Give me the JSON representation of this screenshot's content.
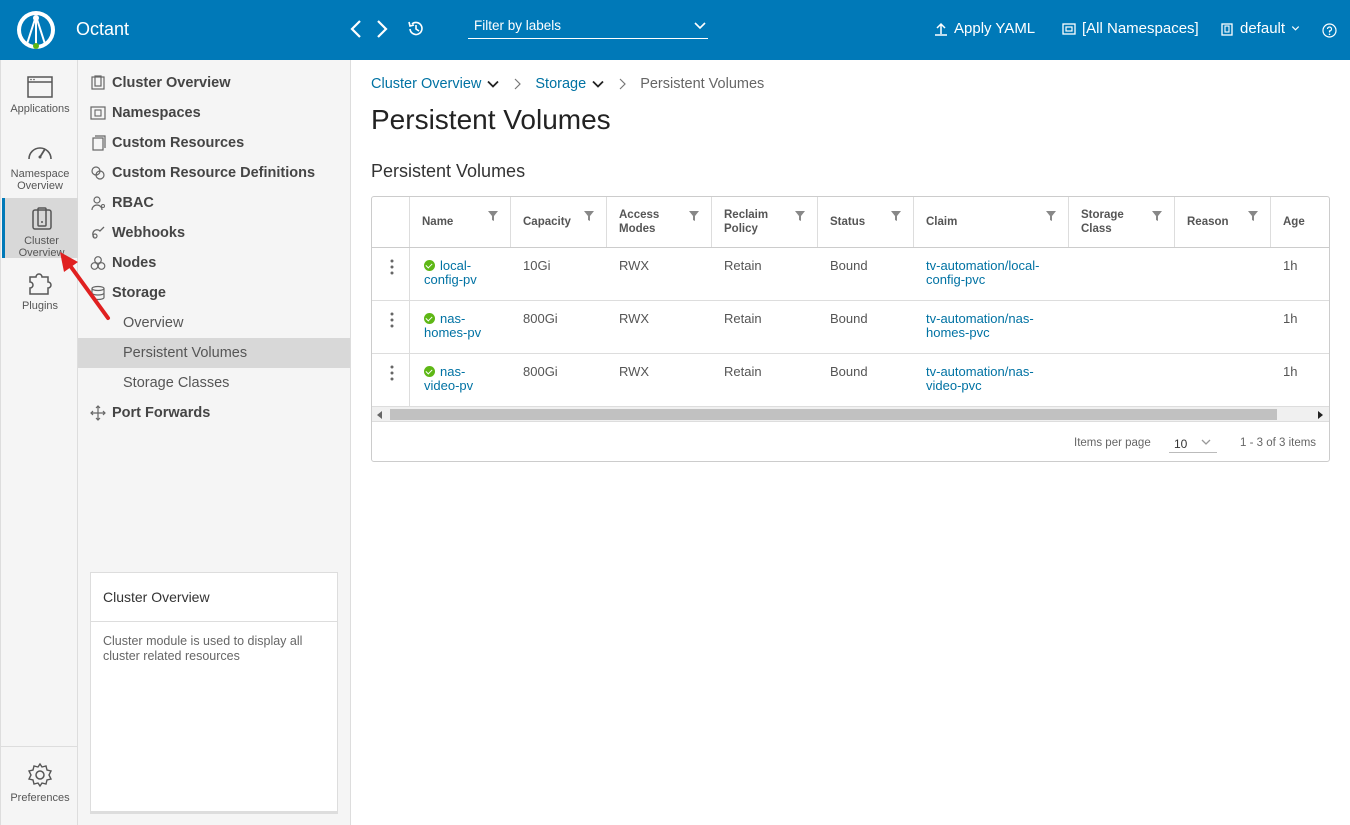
{
  "header": {
    "app_title": "Octant",
    "filter_placeholder": "Filter by labels",
    "apply_yaml": "Apply YAML",
    "namespaces": "[All Namespaces]",
    "context": "default"
  },
  "iconnav": {
    "items": [
      {
        "label": "Applications",
        "icon": "browser-icon"
      },
      {
        "label": "Namespace Overview",
        "icon": "dashboard-icon"
      },
      {
        "label": "Cluster Overview",
        "icon": "cluster-icon"
      },
      {
        "label": "Plugins",
        "icon": "puzzle-icon"
      }
    ],
    "preferences": "Preferences"
  },
  "subnav": {
    "items": [
      "Cluster Overview",
      "Namespaces",
      "Custom Resources",
      "Custom Resource Definitions",
      "RBAC",
      "Webhooks",
      "Nodes",
      "Storage",
      "Port Forwards"
    ],
    "storage_children": [
      "Overview",
      "Persistent Volumes",
      "Storage Classes"
    ],
    "info_card": {
      "title": "Cluster Overview",
      "body": "Cluster module is used to display all cluster related resources"
    }
  },
  "main": {
    "breadcrumb": [
      "Cluster Overview",
      "Storage",
      "Persistent Volumes"
    ],
    "title": "Persistent Volumes",
    "section_title": "Persistent Volumes",
    "columns": [
      "Name",
      "Capacity",
      "Access Modes",
      "Reclaim Policy",
      "Status",
      "Claim",
      "Storage Class",
      "Reason",
      "Age"
    ],
    "rows": [
      {
        "name": "local-config-pv",
        "name_l1": "local-",
        "name_l2": "config-pv",
        "capacity": "10Gi",
        "access": "RWX",
        "reclaim": "Retain",
        "status": "Bound",
        "claim_l1": "tv-automation/local-",
        "claim_l2": "config-pvc",
        "storage_class": "",
        "reason": "",
        "age": "1h"
      },
      {
        "name": "nas-homes-pv",
        "name_l1": "nas-",
        "name_l2": "homes-pv",
        "capacity": "800Gi",
        "access": "RWX",
        "reclaim": "Retain",
        "status": "Bound",
        "claim_l1": "tv-automation/nas-",
        "claim_l2": "homes-pvc",
        "storage_class": "",
        "reason": "",
        "age": "1h"
      },
      {
        "name": "nas-video-pv",
        "name_l1": "nas-",
        "name_l2": "video-pv",
        "capacity": "800Gi",
        "access": "RWX",
        "reclaim": "Retain",
        "status": "Bound",
        "claim_l1": "tv-automation/nas-",
        "claim_l2": "video-pvc",
        "storage_class": "",
        "reason": "",
        "age": "1h"
      }
    ],
    "footer": {
      "items_per_page_label": "Items per page",
      "items_per_page_value": "10",
      "count": "1 - 3 of 3 items"
    }
  },
  "colors": {
    "header_bg": "#0079b8",
    "link": "#0072a3",
    "status_ok": "#5eb715",
    "annotation_arrow": "#e02020"
  }
}
